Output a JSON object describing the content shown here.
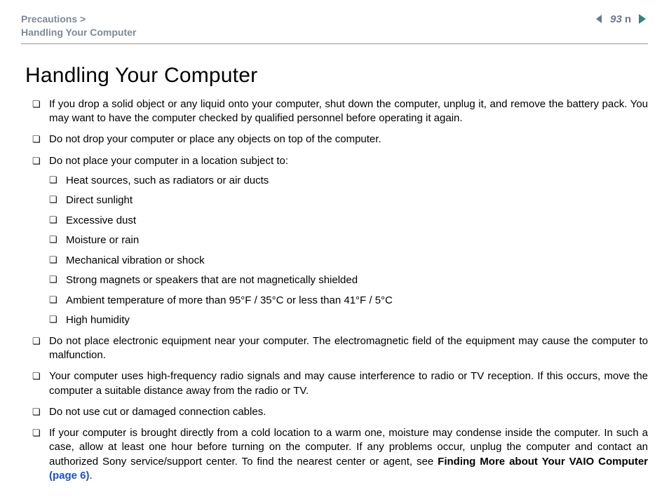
{
  "header": {
    "breadcrumb_section": "Precautions >",
    "breadcrumb_page": "Handling Your Computer",
    "page_number": "93",
    "n_glyph": "n"
  },
  "title": "Handling Your Computer",
  "items": [
    "If you drop a solid object or any liquid onto your computer, shut down the computer, unplug it, and remove the battery pack. You may want to have the computer checked by qualified personnel before operating it again.",
    "Do not drop your computer or place any objects on top of the computer.",
    "Do not place your computer in a location subject to:",
    "Do not place electronic equipment near your computer. The electromagnetic field of the equipment may cause the computer to malfunction.",
    "Your computer uses high-frequency radio signals and may cause interference to radio or TV reception. If this occurs, move the computer a suitable distance away from the radio or TV.",
    "Do not use cut or damaged connection cables."
  ],
  "sub_items": [
    "Heat sources, such as radiators or air ducts",
    "Direct sunlight",
    "Excessive dust",
    "Moisture or rain",
    "Mechanical vibration or shock",
    "Strong magnets or speakers that are not magnetically shielded",
    "Ambient temperature of more than 95°F / 35°C or less than 41°F / 5°C",
    "High humidity"
  ],
  "last_item": {
    "part1": "If your computer is brought directly from a cold location to a warm one, moisture may condense inside the computer. In such a case, allow at least one hour before turning on the computer. If any problems occur, unplug the computer and contact an authorized Sony service/support center. To find the nearest center or agent, see ",
    "bold": "Finding More about Your VAIO Computer ",
    "link": "(page 6)",
    "part2": "."
  }
}
